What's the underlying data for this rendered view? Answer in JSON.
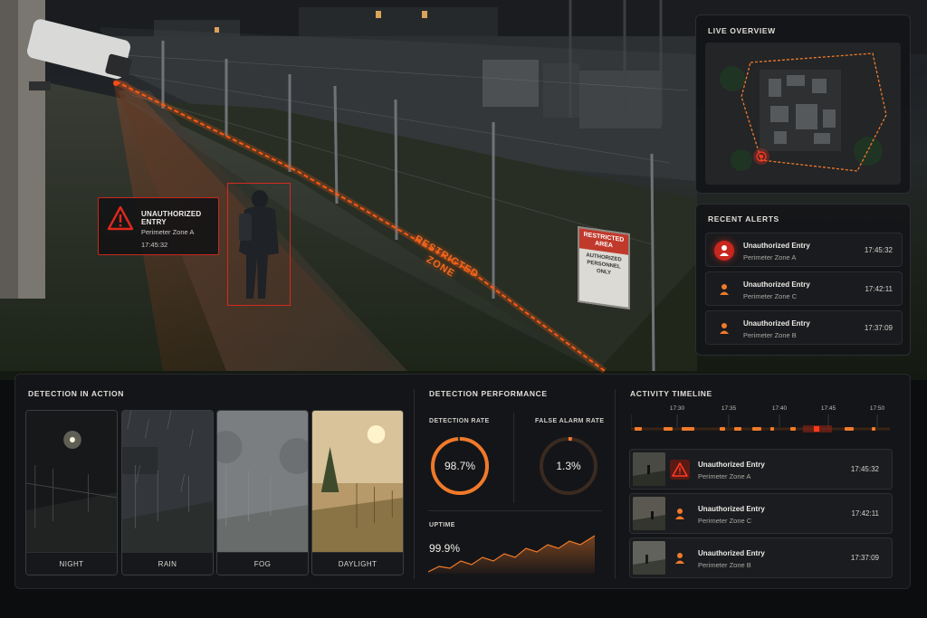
{
  "camera_alert": {
    "title": "UNAUTHORIZED ENTRY",
    "zone": "Perimeter Zone A",
    "time": "17:45:32"
  },
  "scene": {
    "restricted_line1": "RESTRICTED",
    "restricted_line2": "ZONE",
    "sign_top": "RESTRICTED AREA",
    "sign_body": "AUTHORIZED PERSONNEL ONLY"
  },
  "live_overview": {
    "title": "LIVE OVERVIEW"
  },
  "recent_alerts": {
    "title": "RECENT ALERTS",
    "items": [
      {
        "title": "Unauthorized Entry",
        "zone": "Perimeter Zone A",
        "time": "17:45:32"
      },
      {
        "title": "Unauthorized Entry",
        "zone": "Perimeter Zone C",
        "time": "17:42:11"
      },
      {
        "title": "Unauthorized Entry",
        "zone": "Perimeter Zone B",
        "time": "17:37:09"
      }
    ]
  },
  "detection_in_action": {
    "title": "DETECTION IN ACTION",
    "conditions": [
      "NIGHT",
      "RAIN",
      "FOG",
      "DAYLIGHT"
    ]
  },
  "detection_performance": {
    "title": "DETECTION PERFORMANCE",
    "detection_rate_label": "DETECTION RATE",
    "detection_rate": "98.7%",
    "detection_rate_fraction": 0.987,
    "false_alarm_label": "FALSE ALARM RATE",
    "false_alarm_rate": "1.3%",
    "false_alarm_fraction": 0.013,
    "uptime_label": "UPTIME",
    "uptime": "99.9%"
  },
  "activity_timeline": {
    "title": "ACTIVITY TIMELINE",
    "ticks": [
      "17:30",
      "17:35",
      "17:40",
      "17:45",
      "17:50"
    ],
    "items": [
      {
        "title": "Unauthorized Entry",
        "zone": "Perimeter Zone A",
        "time": "17:45:32"
      },
      {
        "title": "Unauthorized Entry",
        "zone": "Perimeter Zone C",
        "time": "17:42:11"
      },
      {
        "title": "Unauthorized Entry",
        "zone": "Perimeter Zone B",
        "time": "17:37:09"
      }
    ]
  },
  "colors": {
    "accent": "#f07a2a",
    "alert_red": "#d42a1f",
    "panel_bg": "#141518"
  }
}
